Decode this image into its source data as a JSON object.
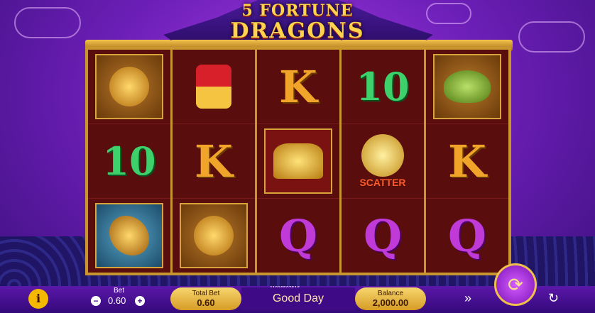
{
  "title": {
    "line1": "5 FORTUNE",
    "line2": "DRAGONS"
  },
  "reels": [
    [
      "lion",
      "10",
      "fish"
    ],
    [
      "ingot-symbol",
      "K",
      "lion"
    ],
    [
      "K",
      "gold-ingot",
      "Q"
    ],
    [
      "10",
      "SCATTER",
      "Q"
    ],
    [
      "turtle",
      "K",
      "Q"
    ]
  ],
  "controls": {
    "info": "i",
    "bet_label": "Bet",
    "bet_value": "0.60",
    "total_bet_label": "Total Bet",
    "total_bet_value": "0.60",
    "message": "Good Day",
    "ticket": "11816503516",
    "balance_label": "Balance",
    "balance_value": "2,000.00",
    "minus": "−",
    "plus": "+"
  },
  "icons": [
    "info-icon",
    "minus-icon",
    "plus-icon",
    "spin-icon",
    "turbo-icon",
    "autoplay-icon"
  ]
}
